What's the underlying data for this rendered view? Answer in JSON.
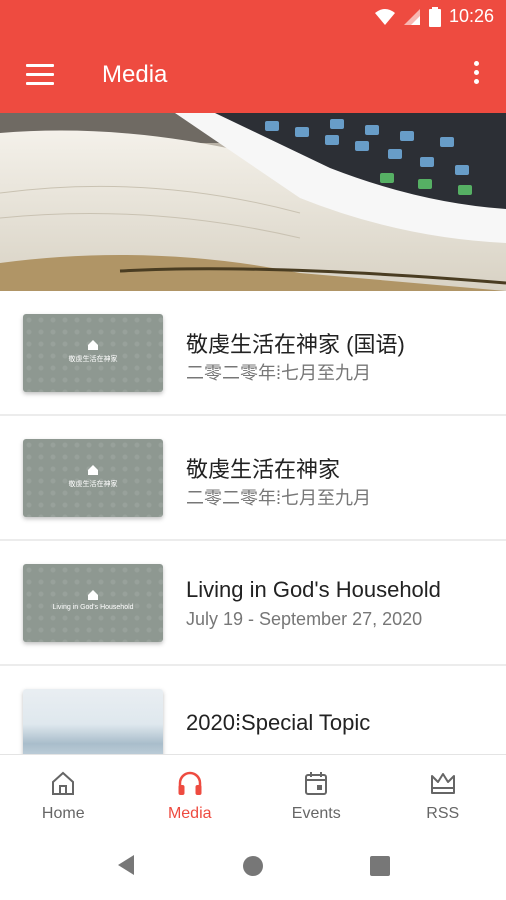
{
  "status": {
    "time": "10:26"
  },
  "appbar": {
    "title": "Media"
  },
  "list": {
    "items": [
      {
        "title": "敬虔生活在神家 (国语)",
        "subtitle": "二零二零年⁞七月至九月",
        "thumb_text": "敬虔生活在神家"
      },
      {
        "title": "敬虔生活在神家",
        "subtitle": "二零二零年⁞七月至九月",
        "thumb_text": "敬虔生活在神家"
      },
      {
        "title": "Living in God's Household",
        "subtitle": "July 19 - September 27, 2020",
        "thumb_text": "Living in God's Household"
      },
      {
        "title": "2020⁞Special Topic"
      }
    ]
  },
  "bottom_nav": {
    "items": [
      {
        "label": "Home",
        "icon": "home-icon"
      },
      {
        "label": "Media",
        "icon": "headphones-icon"
      },
      {
        "label": "Events",
        "icon": "calendar-icon"
      },
      {
        "label": "RSS",
        "icon": "crown-icon"
      }
    ],
    "active": "Media"
  },
  "colors": {
    "accent": "#ee4b40",
    "inactive": "#666666"
  }
}
